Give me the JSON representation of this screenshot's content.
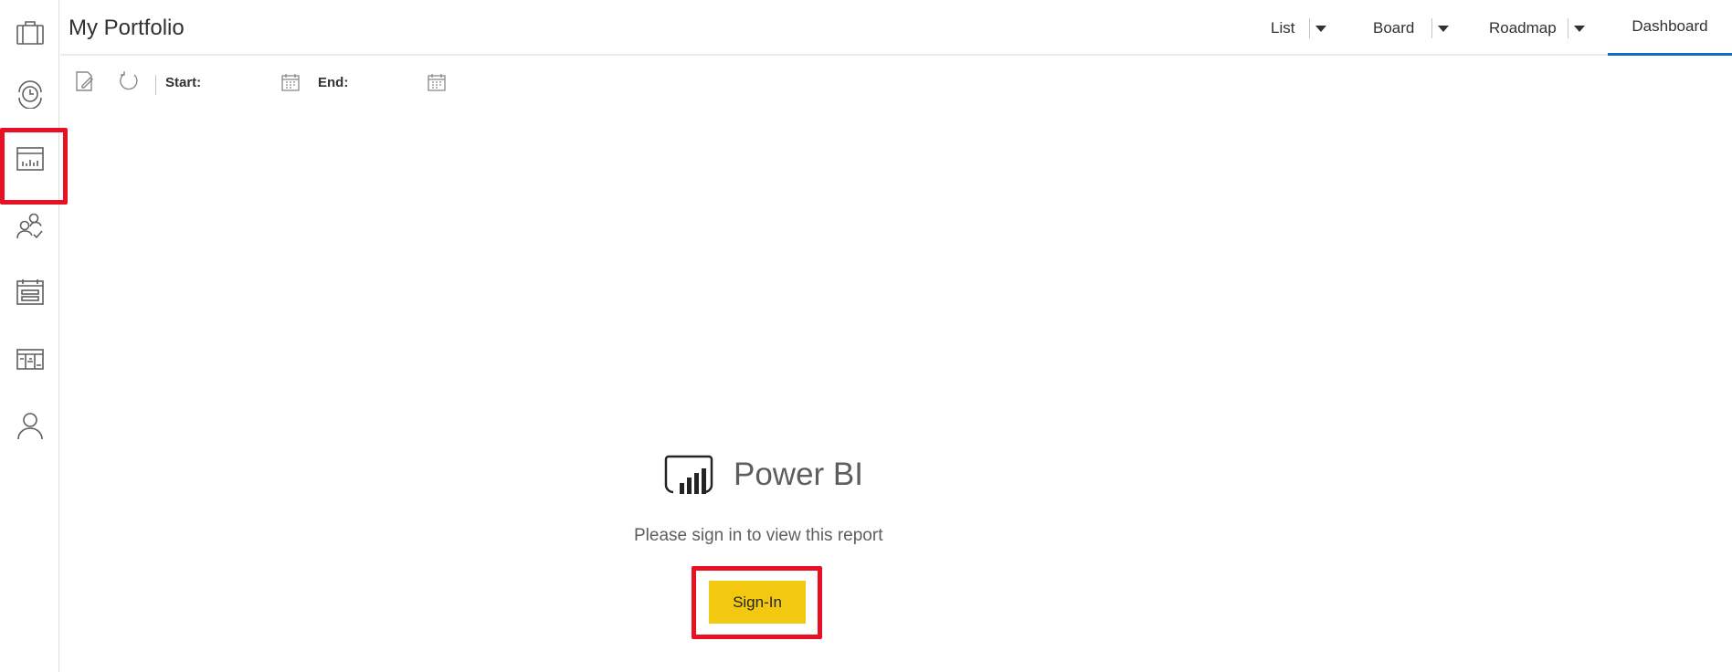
{
  "header": {
    "title": "My Portfolio",
    "views": [
      {
        "label": "List"
      },
      {
        "label": "Board"
      },
      {
        "label": "Roadmap"
      },
      {
        "label": "Dashboard",
        "active": true
      }
    ]
  },
  "toolbar": {
    "start_label": "Start:",
    "end_label": "End:",
    "start_value": "",
    "end_value": ""
  },
  "rail": {
    "items": [
      {
        "icon": "briefcase-icon"
      },
      {
        "icon": "timesheet-icon"
      },
      {
        "icon": "dashboard-icon",
        "highlighted": true
      },
      {
        "icon": "resources-icon"
      },
      {
        "icon": "calendar-icon"
      },
      {
        "icon": "roadmap-icon"
      },
      {
        "icon": "person-icon"
      }
    ]
  },
  "powerbi": {
    "title": "Power BI",
    "message": "Please sign in to view this report",
    "signin_label": "Sign-In"
  },
  "colors": {
    "accent": "#106ebe",
    "signin": "#f2c811",
    "highlight": "#e81123"
  }
}
